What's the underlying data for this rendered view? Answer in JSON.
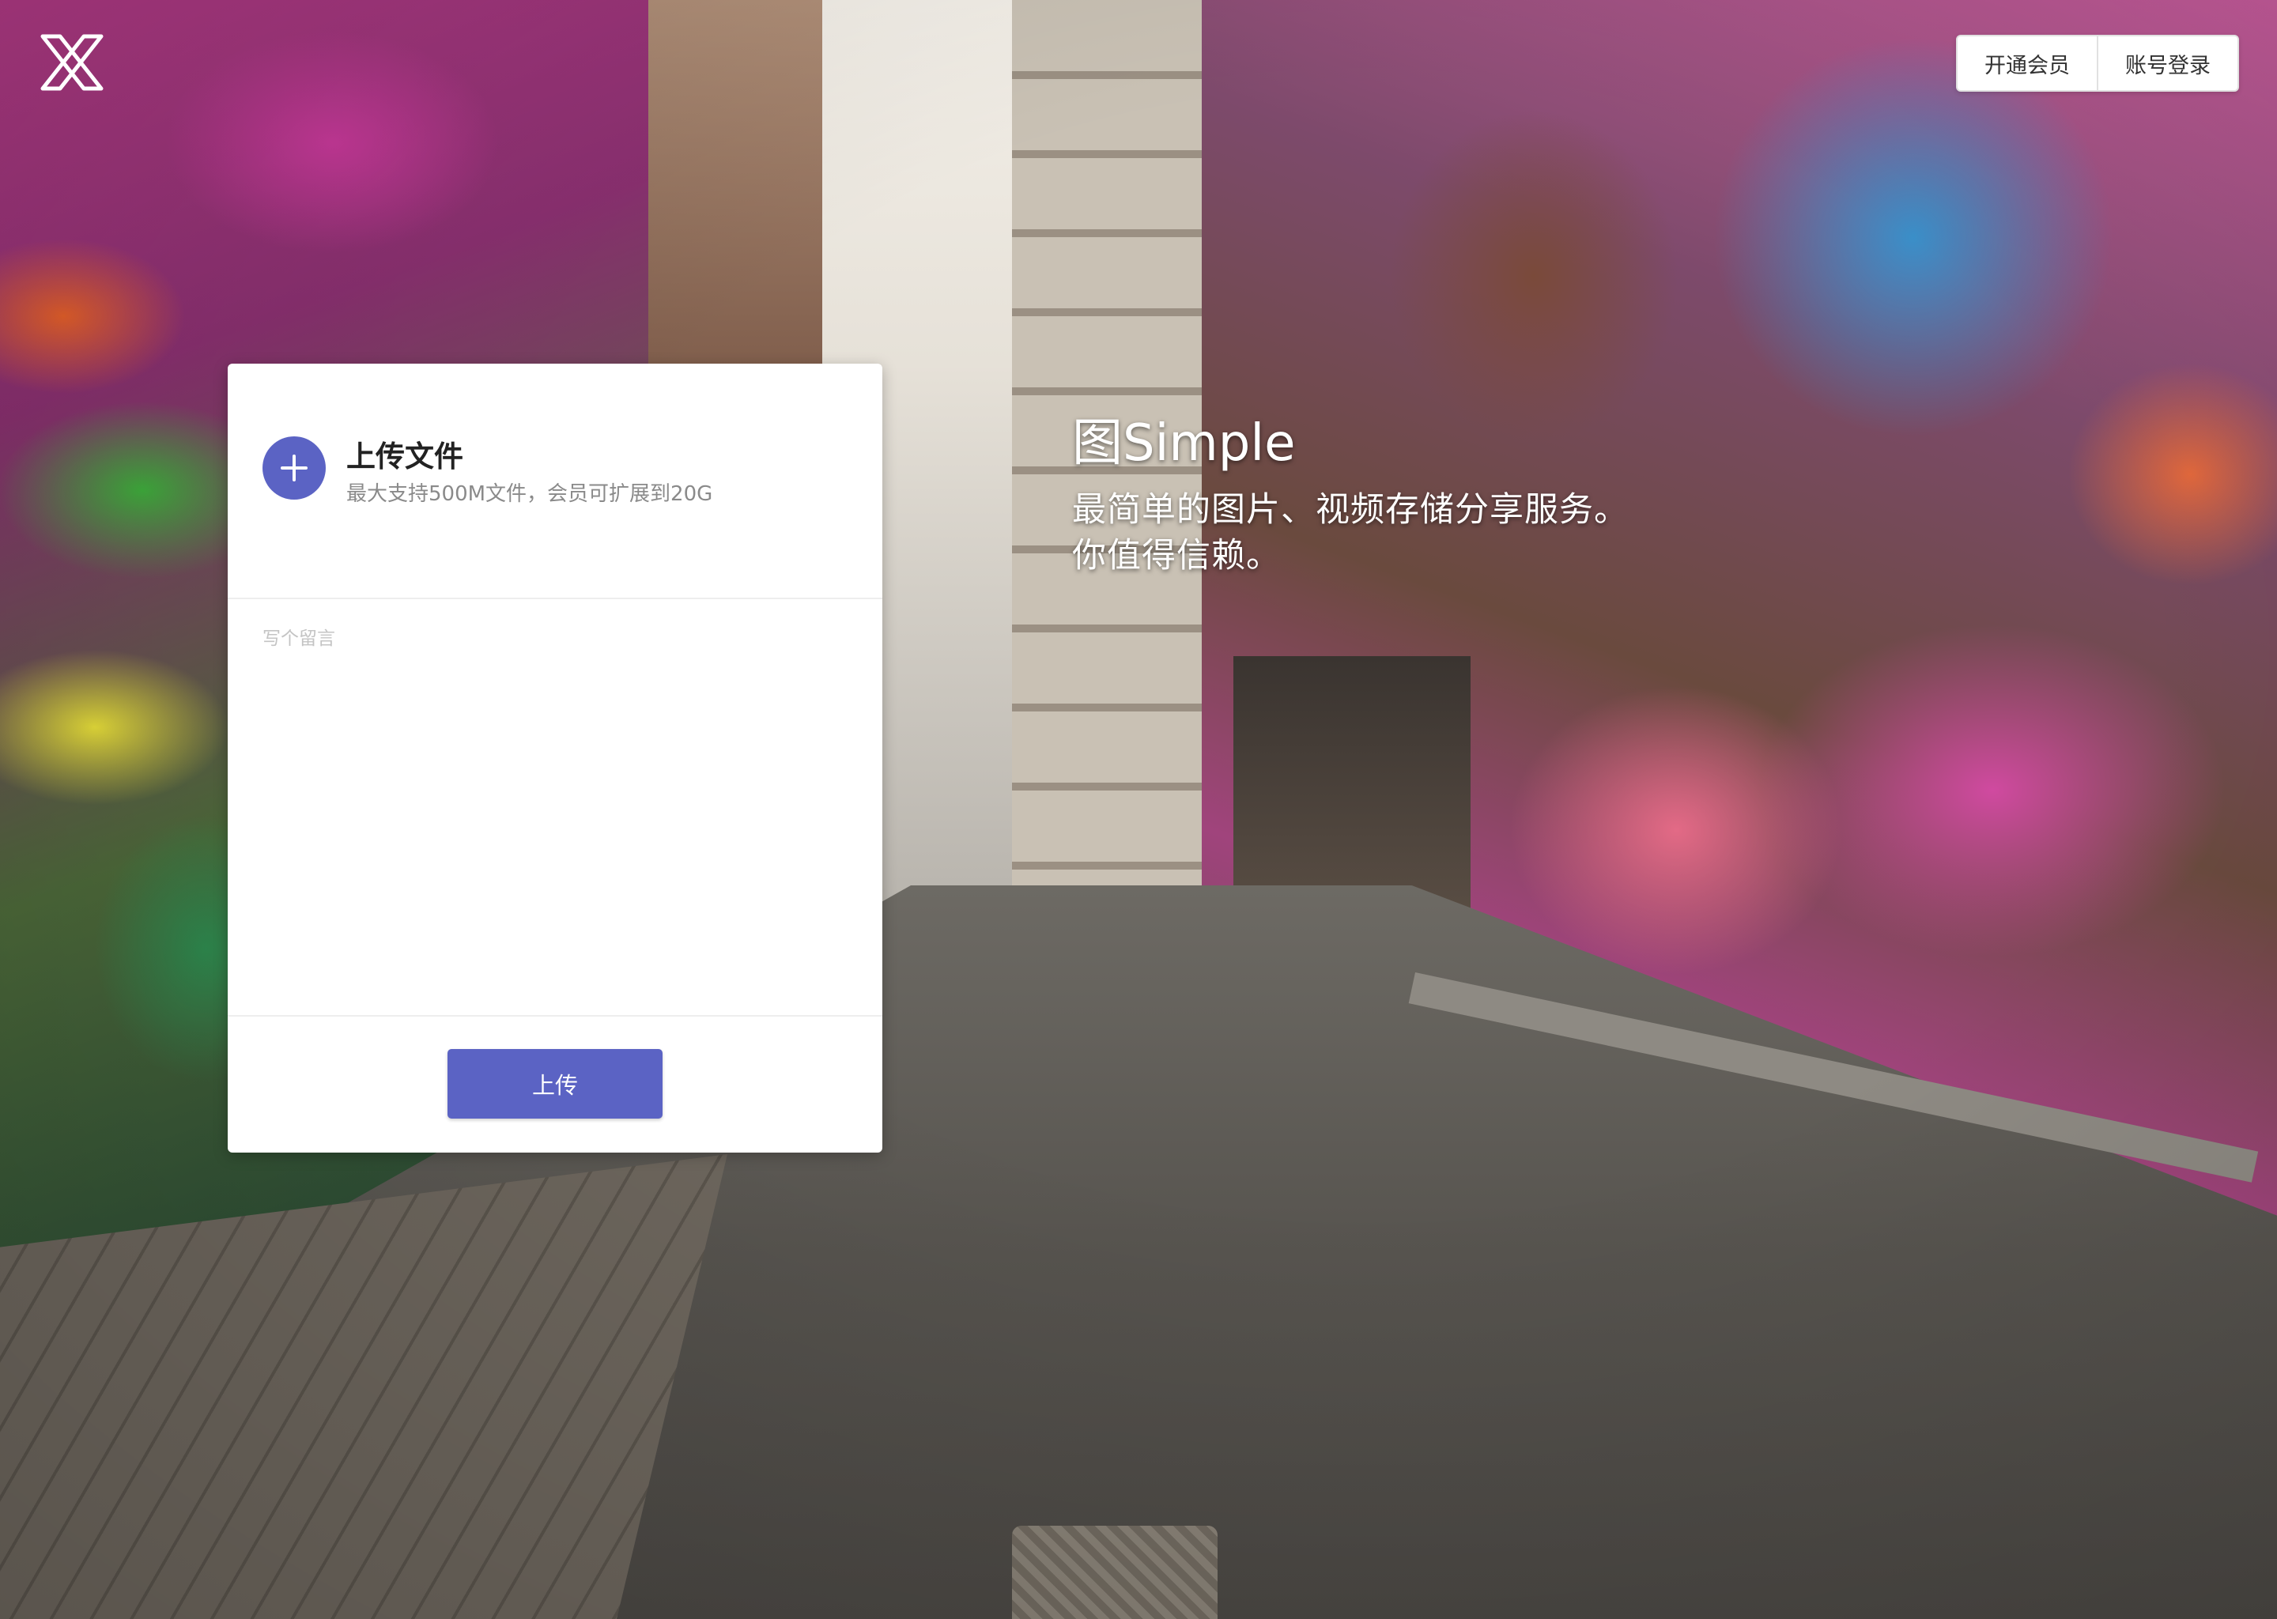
{
  "header": {
    "logo_icon": "x-logo-icon",
    "actions": [
      {
        "label": "开通会员"
      },
      {
        "label": "账号登录"
      }
    ]
  },
  "upload": {
    "add_icon": "plus-icon",
    "title": "上传文件",
    "subtitle": "最大支持500M文件，会员可扩展到20G",
    "message_placeholder": "写个留言",
    "submit_label": "上传",
    "accent_color": "#5b63c4"
  },
  "hero": {
    "title": "图Simple",
    "lines": [
      "最简单的图片、视频存储分享服务。",
      "你值得信赖。"
    ]
  }
}
